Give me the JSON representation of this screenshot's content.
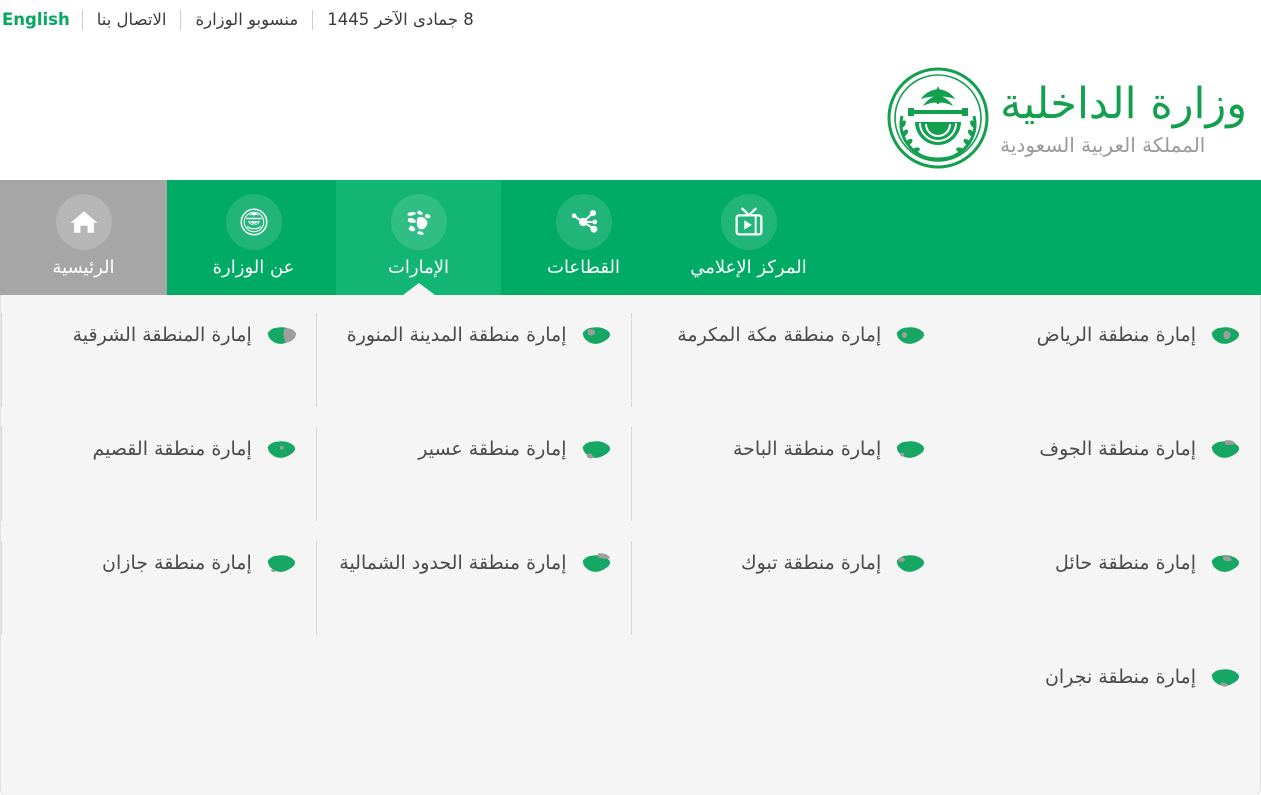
{
  "topbar": {
    "date": "8 جمادى الآخر 1445",
    "staff_link": "منسوبو الوزارة",
    "contact_link": "الاتصال بنا",
    "english_link": "English"
  },
  "header": {
    "logo_title": "وزارة الداخلية",
    "logo_subtitle": "المملكة العربية السعودية",
    "emblem_icon": "saudi-emblem-icon",
    "green": "#12a04f",
    "gray": "#9a9a9a"
  },
  "nav": {
    "background": "#00ab66",
    "active_background": "#12b573",
    "home_background": "#a6a6a6",
    "items": [
      {
        "label": "المركز الإعلامي",
        "icon": "media-tv-icon",
        "state": "default"
      },
      {
        "label": "القطاعات",
        "icon": "share-network-icon",
        "state": "default"
      },
      {
        "label": "الإمارات",
        "icon": "regions-map-icon",
        "state": "active"
      },
      {
        "label": "عن الوزارة",
        "icon": "ministry-emblem-icon",
        "state": "default"
      },
      {
        "label": "الرئيسية",
        "icon": "home-icon",
        "state": "home"
      }
    ]
  },
  "panel": {
    "background": "#f5f5f5",
    "items": [
      {
        "label": "إمارة منطقة الرياض",
        "icon": "saudi-map-riyadh-icon"
      },
      {
        "label": "إمارة منطقة مكة المكرمة",
        "icon": "saudi-map-makkah-icon"
      },
      {
        "label": "إمارة منطقة المدينة المنورة",
        "icon": "saudi-map-madinah-icon"
      },
      {
        "label": "إمارة المنطقة الشرقية",
        "icon": "saudi-map-eastern-icon"
      },
      {
        "label": "إمارة منطقة الجوف",
        "icon": "saudi-map-jawf-icon"
      },
      {
        "label": "إمارة منطقة الباحة",
        "icon": "saudi-map-bahah-icon"
      },
      {
        "label": "إمارة منطقة عسير",
        "icon": "saudi-map-asir-icon"
      },
      {
        "label": "إمارة منطقة القصيم",
        "icon": "saudi-map-qassim-icon"
      },
      {
        "label": "إمارة منطقة حائل",
        "icon": "saudi-map-hail-icon"
      },
      {
        "label": "إمارة منطقة تبوك",
        "icon": "saudi-map-tabuk-icon"
      },
      {
        "label": "إمارة منطقة الحدود الشمالية",
        "icon": "saudi-map-northern-borders-icon"
      },
      {
        "label": "إمارة منطقة جازان",
        "icon": "saudi-map-jazan-icon"
      },
      {
        "label": "إمارة منطقة نجران",
        "icon": "saudi-map-najran-icon"
      }
    ]
  }
}
